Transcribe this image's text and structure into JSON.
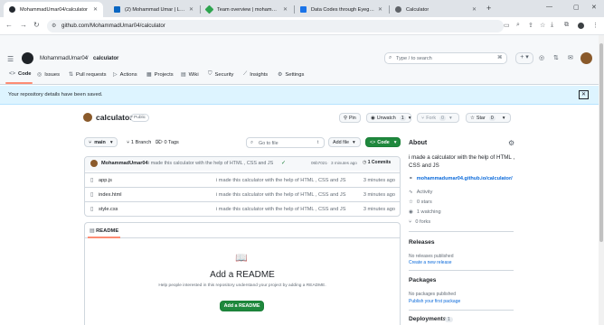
{
  "browser": {
    "tabs": [
      {
        "label": "MohammadUmar04/calculator",
        "active": true,
        "color": "#24292f"
      },
      {
        "label": "(2) Mohammad Umar | LinkedIn",
        "active": false,
        "color": "#0a66c2"
      },
      {
        "label": "Team overview | mohammadum…",
        "active": false,
        "color": "#2ea44f"
      },
      {
        "label": "Data Codes through Eyeglass…",
        "active": false,
        "color": "#1a73e8"
      },
      {
        "label": "Calculator",
        "active": false,
        "color": "#5f6368"
      }
    ],
    "new_tab": "+",
    "url": "github.com/MohammadUmar04/calculator"
  },
  "header": {
    "owner": "MohammadUmar04",
    "slash": "/",
    "repo": "calculator",
    "search_placeholder": "Type / to search",
    "search_key": "⌘"
  },
  "repo_nav": [
    {
      "label": "Code",
      "icon": "<>"
    },
    {
      "label": "Issues",
      "icon": "◎"
    },
    {
      "label": "Pull requests",
      "icon": "⇅"
    },
    {
      "label": "Actions",
      "icon": "▷"
    },
    {
      "label": "Projects",
      "icon": "▦"
    },
    {
      "label": "Wiki",
      "icon": "▤"
    },
    {
      "label": "Security",
      "icon": "⛉"
    },
    {
      "label": "Insights",
      "icon": "⟋"
    },
    {
      "label": "Settings",
      "icon": "⚙"
    }
  ],
  "flash": {
    "message": "Your repository details have been saved."
  },
  "repo_title": {
    "name": "calculator",
    "visibility": "Public",
    "pin": "Pin",
    "unwatch": "Unwatch",
    "unwatch_count": "1",
    "fork": "Fork",
    "fork_count": "0",
    "star": "Star",
    "star_count": "0"
  },
  "branch_bar": {
    "branch": "main",
    "branches": "1 Branch",
    "tags": "0 Tags",
    "goto_placeholder": "Go to file",
    "goto_key": "t",
    "add_file": "Add file",
    "code": "Code"
  },
  "commit": {
    "author": "MohammadUmar04",
    "message": "i made this calculator with the help of HTML , CSS and JS",
    "hash": "06b7021",
    "time": "3 minutes ago",
    "commits": "1 Commits"
  },
  "files": [
    {
      "name": "app.js",
      "message": "i made this calculator with the help of HTML , CSS and JS",
      "time": "3 minutes ago"
    },
    {
      "name": "index.html",
      "message": "i made this calculator with the help of HTML , CSS and JS",
      "time": "3 minutes ago"
    },
    {
      "name": "style.css",
      "message": "i made this calculator with the help of HTML , CSS and JS",
      "time": "3 minutes ago"
    }
  ],
  "readme": {
    "tab": "README",
    "title": "Add a README",
    "text": "Help people interested in this repository understand your project by adding a README.",
    "button": "Add a README"
  },
  "about": {
    "heading": "About",
    "description": "i made a calculator with the help of HTML , CSS and JS",
    "website": "mohammadumar04.github.io/calculator/",
    "activity": "Activity",
    "stars": "0 stars",
    "watching": "1 watching",
    "forks": "0 forks"
  },
  "releases": {
    "heading": "Releases",
    "none": "No releases published",
    "link": "Create a new release"
  },
  "packages": {
    "heading": "Packages",
    "none": "No packages published",
    "link": "Publish your first package"
  },
  "deployments": {
    "heading": "Deployments",
    "count": "1"
  }
}
